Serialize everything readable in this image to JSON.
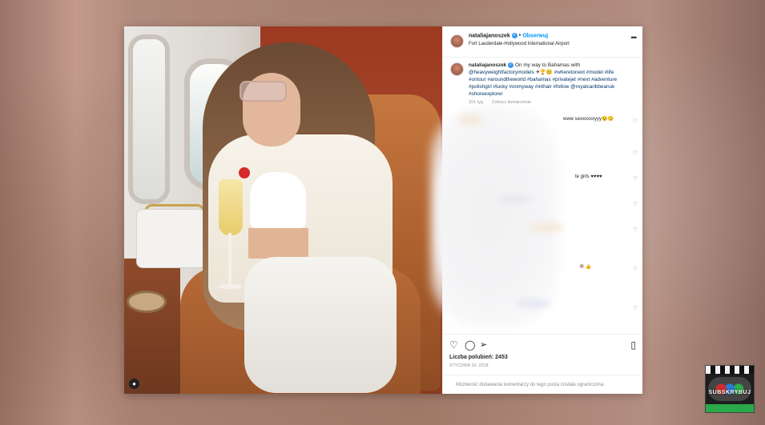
{
  "post": {
    "username": "nataliajanoszek",
    "follow_label": "Obserwuj",
    "location": "Fort Lauderdale-Hollywood International Airport",
    "more_icon": "more-horizontal-icon",
    "caption_user": "nataliajanoszek",
    "caption_text": "On my way to Bahamas with",
    "caption_mention": "@heavyweightfactorymodels",
    "caption_emojis": "✈🏆😊",
    "caption_tags": "#wheretonext #model #life #ontour #aroundtheworld #bahamas #privatejet #next #adventure #polishgirl #lucky #onmyway #inthair #follow @royalcaribbeanuk #shoreexplorer",
    "meta_time": "151 tyg.",
    "meta_translate": "Zobacz tłumaczenie",
    "comment_tails": [
      "www sexxxxxxyyy😉😏",
      "te girls ♥♥♥♥",
      "🍭👍"
    ],
    "likes_label": "Liczba polubień: 2453",
    "date": "STYCZNIA 10, 2018",
    "comments_restricted": "Możliwość dodawania komentarzy do tego posta została ograniczona."
  },
  "logo": {
    "text": "SUBSKRYBUJ"
  },
  "colors": {
    "link": "#00376b",
    "follow": "#0095f6",
    "verified": "#3897f0",
    "muted": "#8e8e8e"
  }
}
